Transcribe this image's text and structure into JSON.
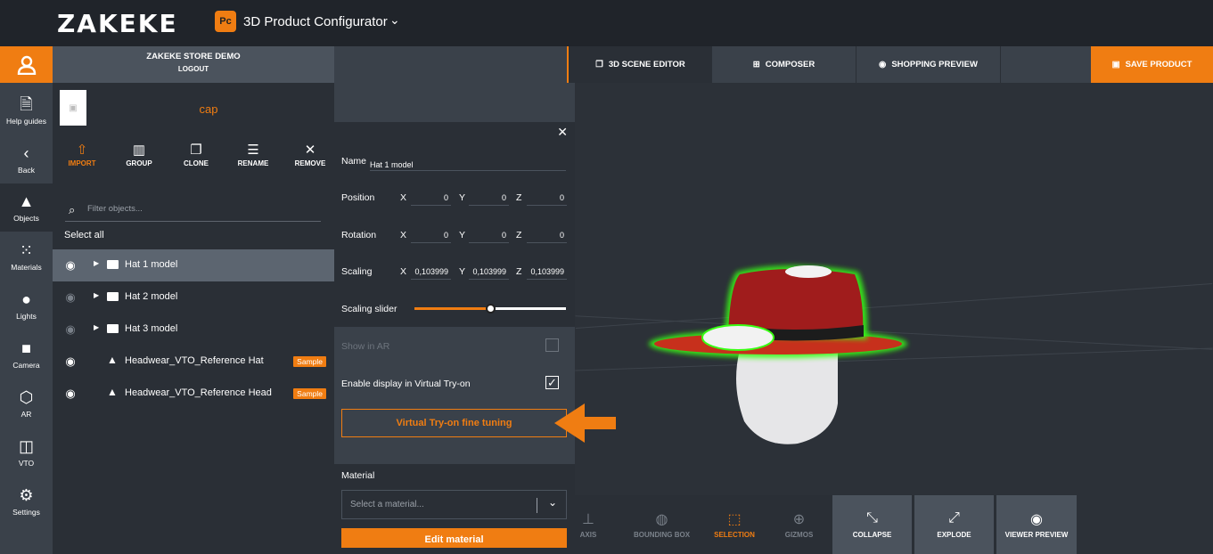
{
  "app": {
    "logo": "ZAKEKE",
    "app_icon": "Pc",
    "title": "3D Product Configurator"
  },
  "store": {
    "name": "ZAKEKE STORE DEMO",
    "logout": "LOGOUT"
  },
  "rail": [
    {
      "label": "Help guides",
      "icon": "document-icon"
    },
    {
      "label": "Back",
      "icon": "chevron-left-icon"
    },
    {
      "label": "Objects",
      "icon": "shapes-icon"
    },
    {
      "label": "Materials",
      "icon": "grid-icon"
    },
    {
      "label": "Lights",
      "icon": "bulb-icon"
    },
    {
      "label": "Camera",
      "icon": "camera-icon"
    },
    {
      "label": "AR",
      "icon": "cube-icon"
    },
    {
      "label": "VTO",
      "icon": "glasses-icon"
    },
    {
      "label": "Settings",
      "icon": "gear-icon"
    }
  ],
  "object": {
    "name": "cap"
  },
  "tools": [
    {
      "label": "IMPORT"
    },
    {
      "label": "GROUP"
    },
    {
      "label": "CLONE"
    },
    {
      "label": "RENAME"
    },
    {
      "label": "REMOVE"
    }
  ],
  "filter": {
    "placeholder": "Filter objects..."
  },
  "select_all": "Select all",
  "objects": [
    {
      "label": "Hat 1 model",
      "visible": true,
      "selected": true,
      "type": "folder"
    },
    {
      "label": "Hat 2 model",
      "visible": false,
      "type": "folder"
    },
    {
      "label": "Hat 3 model",
      "visible": false,
      "type": "folder"
    },
    {
      "label": "Headwear_VTO_Reference Hat",
      "visible": true,
      "type": "mesh",
      "badge": "Sample"
    },
    {
      "label": "Headwear_VTO_Reference Head",
      "visible": true,
      "type": "mesh",
      "badge": "Sample"
    }
  ],
  "props": {
    "name_label": "Name",
    "name_value": "Hat 1 model",
    "position_label": "Position",
    "rotation_label": "Rotation",
    "scaling_label": "Scaling",
    "slider_label": "Scaling slider",
    "slider_value": 0.5,
    "axes": {
      "x": "X",
      "y": "Y",
      "z": "Z"
    },
    "position": {
      "x": "0",
      "y": "0",
      "z": "0"
    },
    "rotation": {
      "x": "0",
      "y": "0",
      "z": "0"
    },
    "scaling": {
      "x": "0,103999",
      "y": "0,103999",
      "z": "0,103999"
    },
    "show_ar_label": "Show in AR",
    "show_ar_checked": false,
    "vto_label": "Enable display in Virtual Try-on",
    "vto_checked": true,
    "fine_tuning": "Virtual Try-on fine tuning",
    "material_label": "Material",
    "material_placeholder": "Select a material...",
    "edit_material": "Edit material"
  },
  "tabs": [
    {
      "label": "3D SCENE EDITOR",
      "icon": "layers-icon"
    },
    {
      "label": "COMPOSER",
      "icon": "composer-icon"
    },
    {
      "label": "SHOPPING PREVIEW",
      "icon": "eye-icon"
    }
  ],
  "save": "SAVE PRODUCT",
  "bottom_tools": [
    {
      "label": "AXIS",
      "icon": "axis-icon"
    },
    {
      "label": "BOUNDING BOX",
      "icon": "bounding-box-icon"
    },
    {
      "label": "SELECTION",
      "icon": "selection-icon"
    },
    {
      "label": "GIZMOS",
      "icon": "gizmos-icon"
    },
    {
      "label": "COLLAPSE",
      "icon": "collapse-icon"
    },
    {
      "label": "EXPLODE",
      "icon": "explode-icon"
    },
    {
      "label": "VIEWER PREVIEW",
      "icon": "eye-icon"
    }
  ],
  "colors": {
    "accent": "#f07d12",
    "hat": "#a01c1c",
    "outline": "#39ff14"
  }
}
